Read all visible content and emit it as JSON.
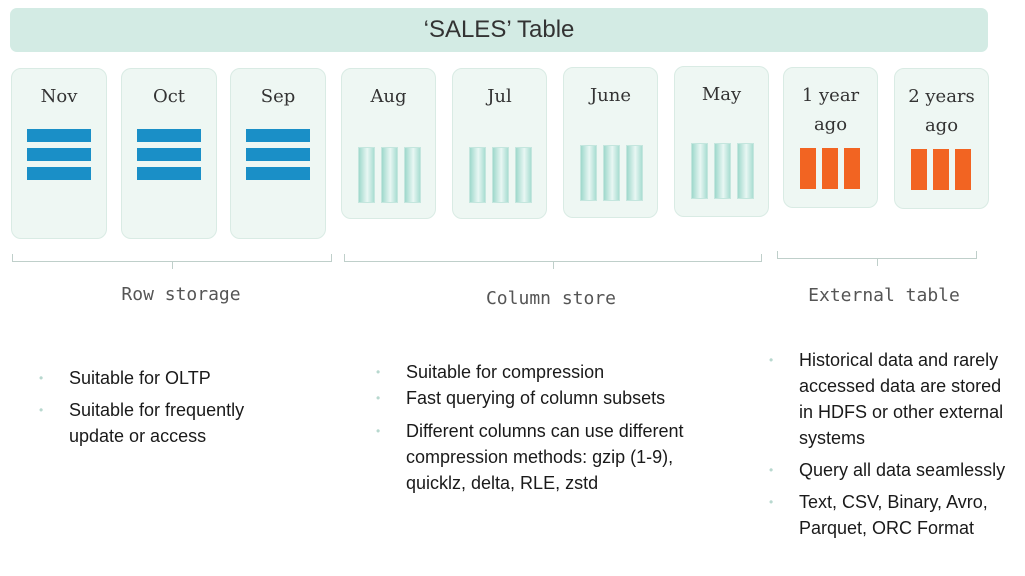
{
  "title": "‘SALES’ Table",
  "row_cards": [
    "Nov",
    "Oct",
    "Sep"
  ],
  "column_cards": [
    "Aug",
    "Jul",
    "June",
    "May"
  ],
  "external_cards": [
    [
      "1 year",
      "ago"
    ],
    [
      "2 years",
      "ago"
    ]
  ],
  "groups": {
    "row": {
      "label": "Row storage",
      "bullets": [
        [
          "Suitable for OLTP"
        ],
        [
          "Suitable for frequently",
          "update or access"
        ]
      ]
    },
    "column": {
      "label": "Column store",
      "bullets": [
        [
          "Suitable for compression"
        ],
        [
          "Fast querying of column subsets"
        ],
        [
          "Different columns can use different",
          "compression methods: gzip (1-9),",
          "quicklz, delta, RLE, zstd"
        ]
      ]
    },
    "external": {
      "label": "External table",
      "bullets": [
        [
          "Historical data and rarely",
          "accessed data are stored",
          "in HDFS or other external",
          "systems"
        ],
        [
          "Query all data seamlessly"
        ],
        [
          "Text, CSV, Binary, Avro,",
          "Parquet,   ORC Format"
        ]
      ]
    }
  },
  "colors": {
    "row_bar": "#1a8fc7",
    "column_bar": "#a9ddd2",
    "external_bar": "#f26422",
    "title_bg": "#d3ebe4"
  }
}
